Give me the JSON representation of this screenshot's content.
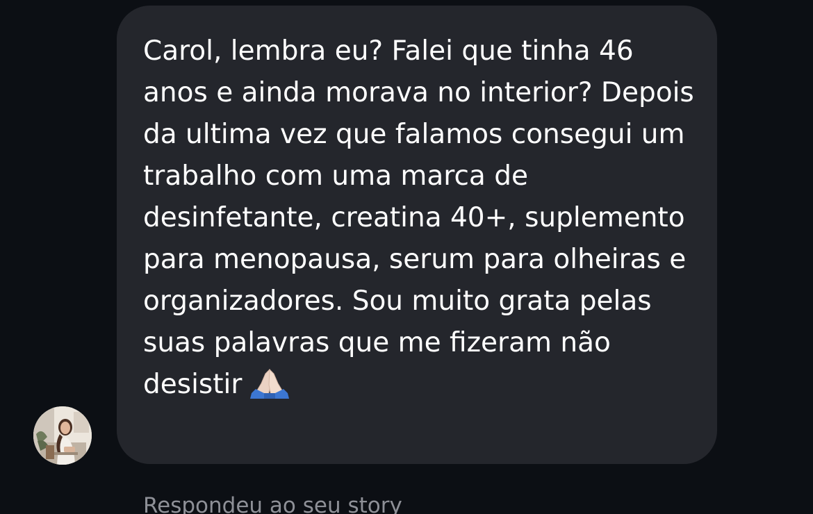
{
  "conversation": {
    "message": {
      "text": "Carol, lembra eu? Falei que tinha 46 anos e ainda morava no interior? Depois da ultima vez que falamos consegui um trabalho com uma marca de desinfetante, creatina 40+, suplemento para menopausa, serum para olheiras e organizadores. Sou muito grata pelas suas palavras que me fizeram não desistir",
      "emoji": "folded-hands-icon"
    },
    "reply_caption": "Respondeu ao seu story"
  },
  "colors": {
    "background": "#0c0f14",
    "bubble": "#24262c",
    "message_text": "#ffffff",
    "caption_text": "#8e9097"
  }
}
